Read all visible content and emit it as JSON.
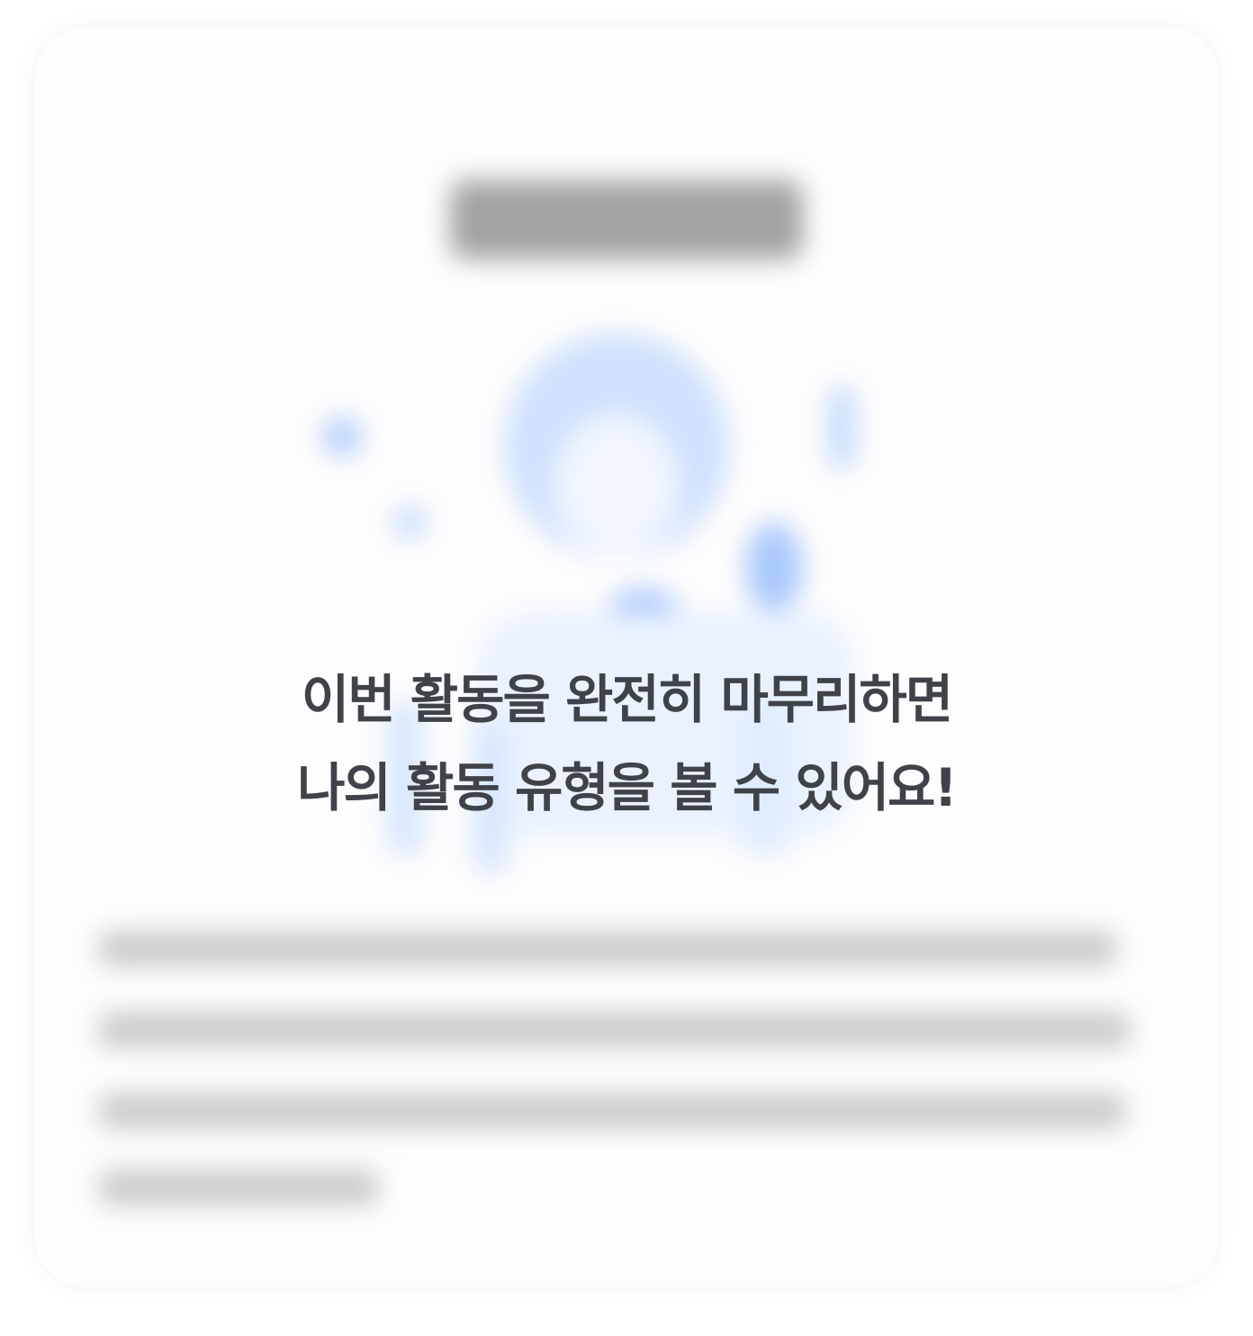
{
  "overlay": {
    "line1": "이번 활동을 완전히 마무리하면",
    "line2": "나의 활동 유형을 볼 수 있어요!"
  },
  "colors": {
    "text": "#3f4349",
    "illustration_blue": "#a9c8fb",
    "card_background": "#fdfdfd"
  }
}
